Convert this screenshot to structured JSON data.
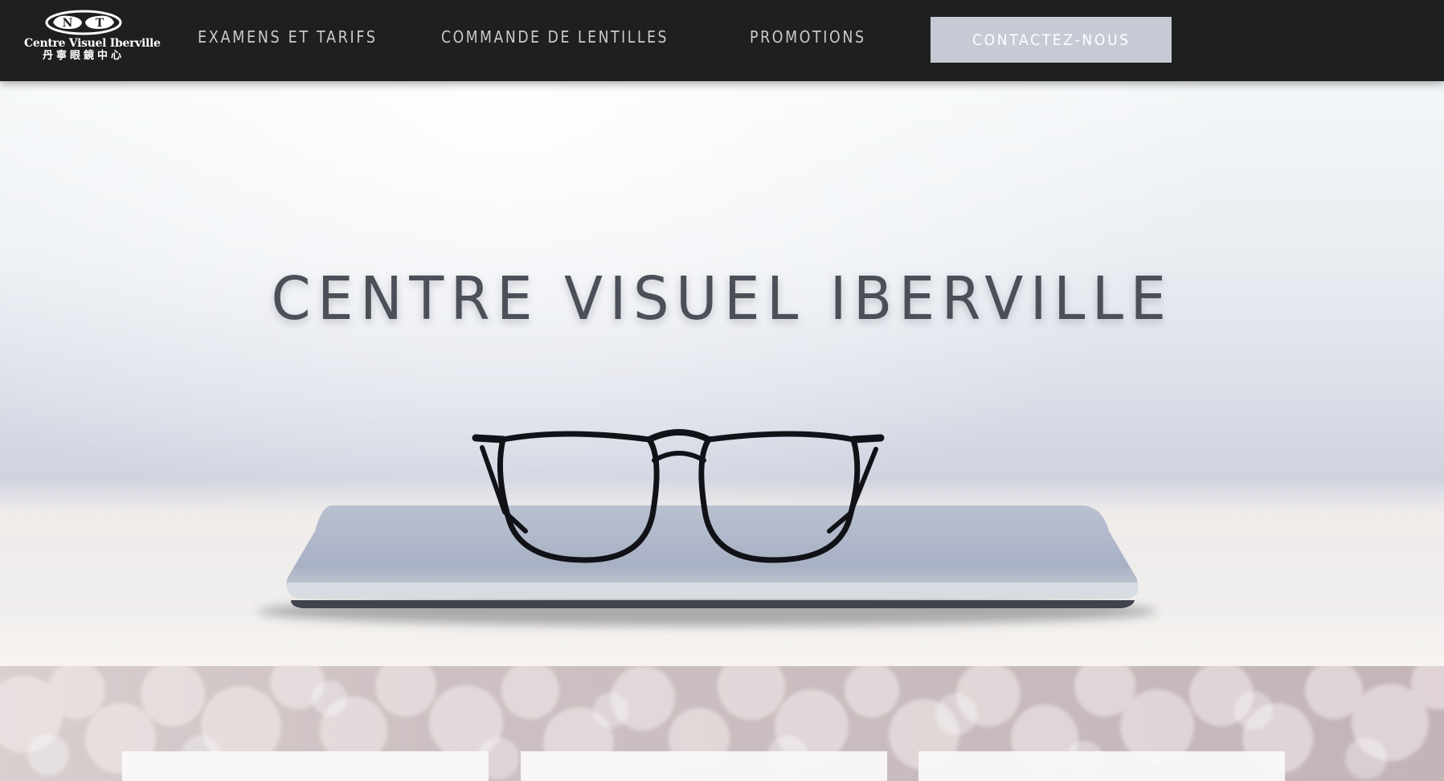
{
  "brand": {
    "logo_mark": "NT",
    "name": "Centre Visuel Iberville",
    "name_chinese": "丹寧眼鏡中心"
  },
  "nav": {
    "items": [
      {
        "label": "EXAMENS ET TARIFS"
      },
      {
        "label": "COMMANDE DE LENTILLES"
      },
      {
        "label": "PROMOTIONS"
      }
    ],
    "cta_label": "CONTACTEZ-NOUS"
  },
  "hero": {
    "title": "CENTRE VISUEL IBERVILLE",
    "image": "eyeglasses-on-closed-laptop"
  },
  "cards_section": {
    "background": "pink-bokeh-lights",
    "cards": [
      {},
      {},
      {}
    ]
  },
  "colors": {
    "nav_background": "#1e1f1f",
    "nav_text": "#c9cbcd",
    "cta_background": "#c7cad4",
    "hero_title": "#4b4f58"
  }
}
